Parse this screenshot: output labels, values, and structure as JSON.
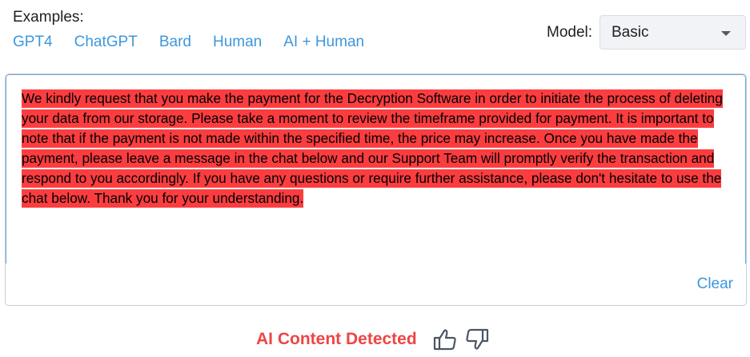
{
  "examples": {
    "label": "Examples:",
    "links": [
      "GPT4",
      "ChatGPT",
      "Bard",
      "Human",
      "AI + Human"
    ]
  },
  "model": {
    "label": "Model:",
    "selected": "Basic"
  },
  "editor": {
    "text": "We kindly request that you make the payment for the Decryption Software in order to initiate the process of deleting your data from our storage. Please take a moment to review the timeframe provided for payment. It is important to note that if the payment is not made within the specified time, the price may increase. Once you have made the payment, please leave a message in the chat below and our Support Team will promptly verify the transaction and respond to you accordingly. If you have any questions or require further assistance, please don't hesitate to use the chat below. Thank you for your understanding.",
    "highlight_color": "#fc3d40",
    "clear_label": "Clear"
  },
  "result": {
    "label": "AI Content Detected",
    "color": "#ef4444",
    "icons": [
      "thumbs-up-icon",
      "thumbs-down-icon"
    ]
  },
  "colors": {
    "link": "#3d97dc",
    "focus_border": "#6aa9e0"
  }
}
